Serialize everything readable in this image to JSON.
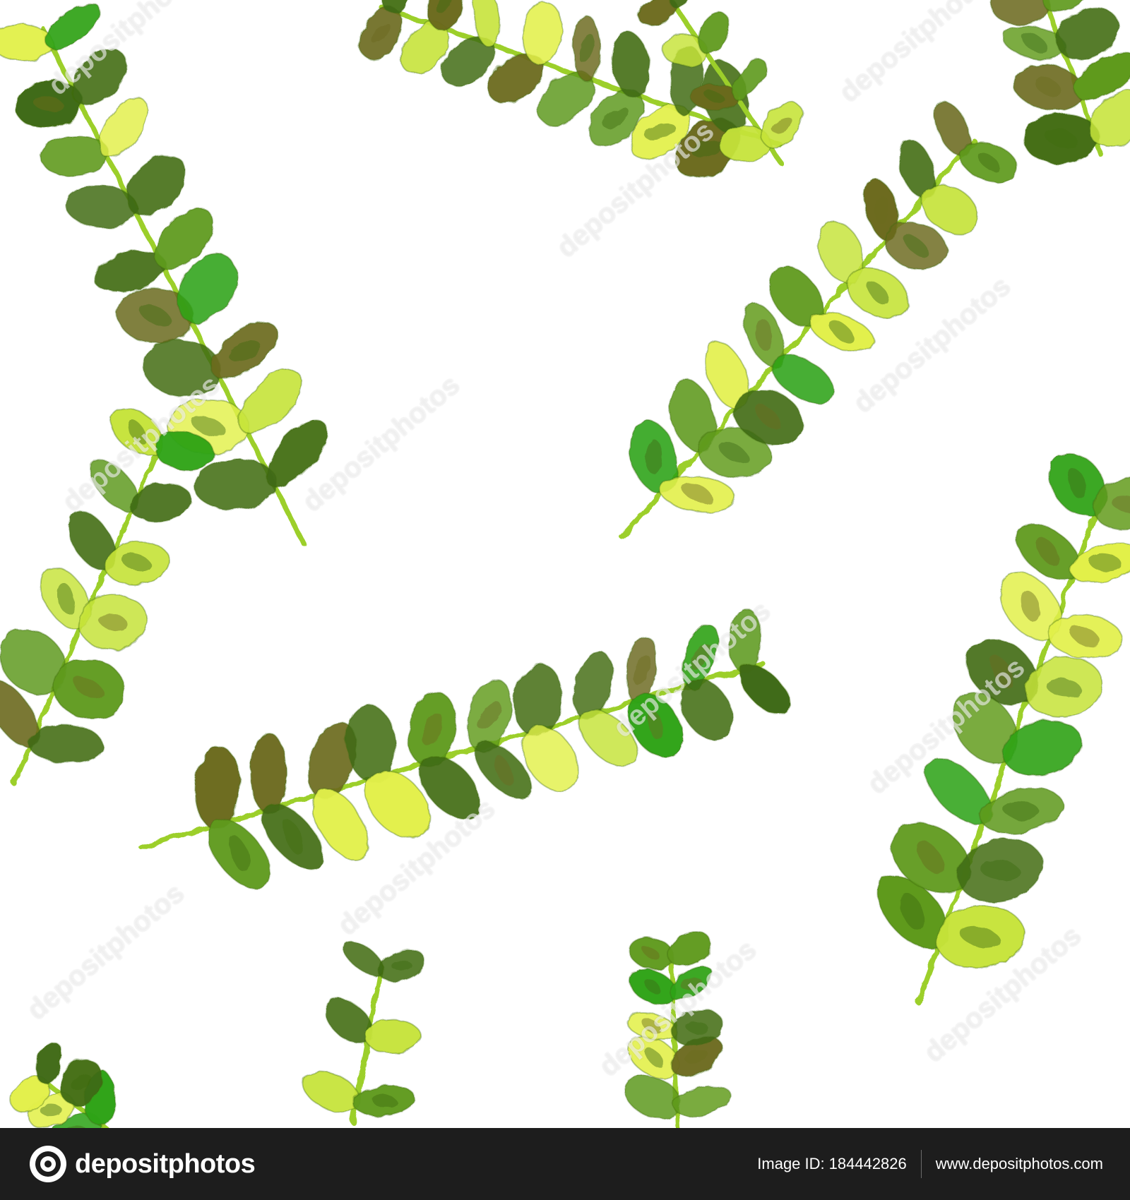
{
  "artwork": {
    "subject": "Seamless watercolor pattern of green eucalyptus branches on white",
    "colors": {
      "background": "#ffffff",
      "dark_green": "#3f6a12",
      "mid_green": "#5f9a1c",
      "bright_green": "#2fa318",
      "olive": "#6b6a1e",
      "lime": "#c6e33a",
      "yellow_lime": "#e2f04a",
      "stem": "#9ccf2c"
    },
    "watermark_text": "depositphotos"
  },
  "footer": {
    "brand": "depositphotos",
    "image_id_label": "Image ID:",
    "image_id": "184442826",
    "site_url": "www.depositphotos.com",
    "colors": {
      "bar": "#1d1d1d",
      "text": "#ffffff"
    }
  }
}
